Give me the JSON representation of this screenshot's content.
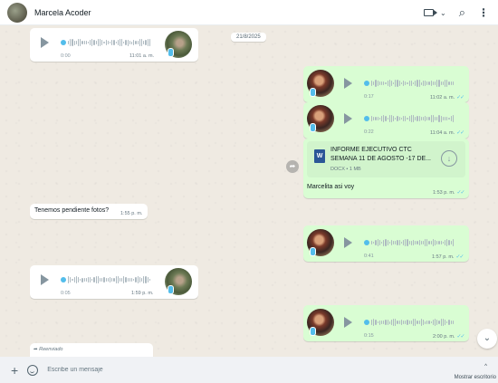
{
  "header": {
    "contact_name": "Marcela Acoder",
    "icons": [
      "video-call-icon",
      "chevron-down-icon",
      "search-icon",
      "menu-icon"
    ],
    "search_glyph": "⌕",
    "menu_glyph": "⋮",
    "chevron_glyph": "⌄"
  },
  "chat": {
    "date_separator": "21/8/2025",
    "messages": [
      {
        "dir": "in",
        "type": "voice",
        "duration": "0:00",
        "time": "11:01 a. m."
      },
      {
        "dir": "out",
        "type": "voice",
        "duration": "0:17",
        "time": "11:02 a. m.",
        "ticks": "✓✓"
      },
      {
        "dir": "out",
        "type": "voice",
        "duration": "0:22",
        "time": "11:04 a. m.",
        "ticks": "✓✓"
      },
      {
        "dir": "out",
        "type": "document",
        "icon_letter": "W",
        "title_line1": "INFORME EJECUTIVO CTC",
        "title_line2": "SEMANA 11 DE AGOSTO -17 DE...",
        "meta": "DOCX • 1 MB",
        "caption": "Marcelita asi voy",
        "time": "1:53 p. m.",
        "ticks": "✓✓"
      },
      {
        "dir": "in",
        "type": "text",
        "text": "Tenemos pendiente fotos?",
        "time": "1:55 p. m."
      },
      {
        "dir": "out",
        "type": "voice",
        "duration": "0:41",
        "time": "1:57 p. m.",
        "ticks": "✓✓"
      },
      {
        "dir": "in",
        "type": "voice",
        "duration": "0:05",
        "time": "1:59 p. m."
      },
      {
        "dir": "out",
        "type": "voice",
        "duration": "0:15",
        "time": "2:00 p. m.",
        "ticks": "✓✓"
      },
      {
        "dir": "in",
        "type": "forwarded",
        "label": "Reenviado"
      }
    ],
    "forward_glyph": "➦",
    "scroll_down_glyph": "⌄"
  },
  "footer": {
    "plus_label": "+",
    "placeholder": "Escribe un mensaje",
    "show_desktop": "Mostrar escritorio",
    "caret_up": "^"
  },
  "colors": {
    "incoming": "#ffffff",
    "outgoing": "#d9fdd3",
    "background": "#efeae2",
    "read_ticks": "#53bdeb"
  }
}
